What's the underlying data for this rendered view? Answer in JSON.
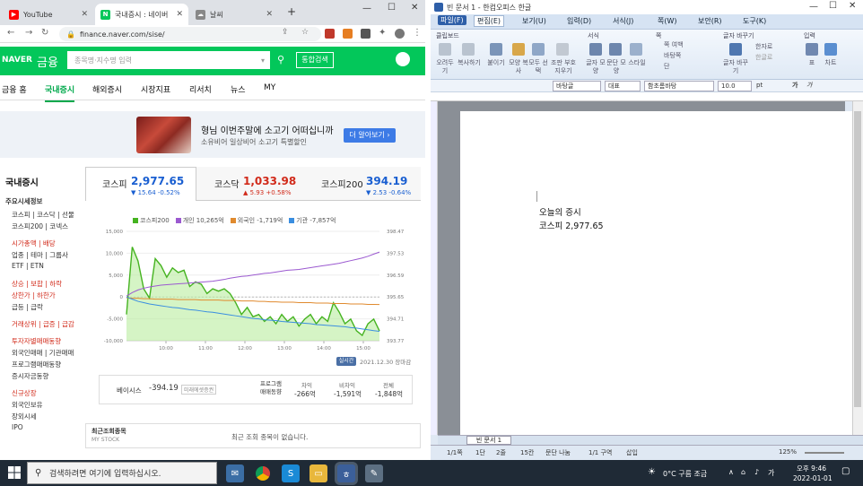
{
  "browser": {
    "tabs": [
      {
        "title": "YouTube"
      },
      {
        "title": "국내증시 : 네이버"
      },
      {
        "title": "날씨"
      }
    ],
    "url": "finance.naver.com/sise/",
    "naver": {
      "logo": "NAVER",
      "section": "금융",
      "search_placeholder": "종목명·지수명 입력",
      "integrated_search": "통합검색",
      "menu": [
        "금융 홈",
        "국내증시",
        "해외증시",
        "시장지표",
        "리서치",
        "뉴스",
        "MY"
      ],
      "ad": {
        "title": "형님 이번주말에 소고기 어떠십니까",
        "sub": "소유비어 일상비어 소고기 특별할인",
        "button": "더 알아보기 ›"
      },
      "sidebar": {
        "title": "국내증시",
        "section1": "주요시세정보",
        "links1": [
          "코스피 | 코스닥 | 선물",
          "코스피200 | 코넥스"
        ],
        "links2": [
          "시가총액 | 배당",
          "업종 | 테마 | 그룹사",
          "ETF | ETN"
        ],
        "links3": [
          "상승 | 보합 | 하락",
          "상한가 | 하한가",
          "급등 | 급락"
        ],
        "links4": [
          "거래상위 | 급증 | 급감"
        ],
        "links5": [
          "투자자별매매동향",
          "외국인매매 | 기관매매",
          "프로그램매매동향",
          "증시자금동향"
        ],
        "section2": "신규상장",
        "links6": [
          "외국인보유",
          "장외시세",
          "IPO"
        ]
      },
      "indices": [
        {
          "name": "코스피",
          "value": "2,977.65",
          "change": "▼ 15.64 -0.52%",
          "dir": "dn"
        },
        {
          "name": "코스닥",
          "value": "1,033.98",
          "change": "▲ 5.93 +0.58%",
          "dir": "up"
        },
        {
          "name": "코스피200",
          "value": "394.19",
          "change": "▼ 2.53 -0.64%",
          "dir": "dn"
        }
      ],
      "legend": [
        "코스피200",
        "개인 10,265억",
        "외국인 -1,719억",
        "기관 -7,857억"
      ],
      "asof": "2021.12.30 장마감",
      "realtime": "실시간",
      "basis": {
        "label": "베이시스",
        "value": "-394.19",
        "tag": "미래에셋증권"
      },
      "program": {
        "label": "프로그램 매매동향",
        "cols": [
          {
            "h": "차익",
            "v": "-266억"
          },
          {
            "h": "비차익",
            "v": "-1,591억"
          },
          {
            "h": "전체",
            "v": "-1,848억"
          }
        ]
      },
      "recent": {
        "label": "최근조회종목",
        "sub": "MY STOCK",
        "empty": "최근 조회 종목이 없습니다."
      }
    }
  },
  "chart_data": {
    "type": "line",
    "x_ticks": [
      "10:00",
      "11:00",
      "12:00",
      "13:00",
      "14:00",
      "15:00"
    ],
    "left_axis": {
      "ticks": [
        "15,000",
        "10,000",
        "5,000",
        "0",
        "-5,000",
        "-10,000"
      ],
      "range": [
        -10000,
        15000
      ]
    },
    "right_axis": {
      "ticks": [
        "398.47",
        "397.53",
        "396.59",
        "395.65",
        "394.71",
        "393.77"
      ],
      "range": [
        393.77,
        398.47
      ]
    },
    "series": [
      {
        "name": "코스피200",
        "color": "#45b320",
        "values": [
          394.9,
          397.8,
          397.2,
          396.0,
          395.6,
          397.3,
          397.0,
          396.5,
          396.9,
          396.7,
          396.8,
          396.1,
          396.3,
          396.2,
          395.8,
          396.0,
          395.9,
          396.0,
          395.8,
          395.4,
          394.9,
          395.2,
          394.8,
          394.9,
          394.6,
          394.8,
          394.5,
          394.9,
          394.6,
          394.8,
          394.4,
          394.7,
          394.9,
          394.5,
          394.8,
          394.6,
          395.4,
          395.0,
          394.5,
          394.7,
          394.2,
          394.0,
          394.5,
          394.7,
          394.19
        ]
      },
      {
        "name": "개인",
        "color": "#9b59d0",
        "values": [
          200,
          1000,
          1600,
          2000,
          2300,
          2500,
          2700,
          2800,
          2900,
          3000,
          3100,
          3200,
          3300,
          3400,
          3500,
          3600,
          3800,
          4000,
          4300,
          4500,
          4700,
          4800,
          5000,
          5200,
          5400,
          5500,
          5700,
          5900,
          6100,
          6200,
          6300,
          6500,
          6700,
          6900,
          7100,
          7300,
          7500,
          7700,
          8000,
          8300,
          8600,
          8900,
          9300,
          9800,
          10265
        ]
      },
      {
        "name": "외국인",
        "color": "#e08a2e",
        "values": [
          -200,
          -300,
          -300,
          -400,
          -400,
          -500,
          -500,
          -500,
          -500,
          -600,
          -600,
          -600,
          -600,
          -700,
          -700,
          -700,
          -700,
          -800,
          -800,
          -800,
          -900,
          -900,
          -900,
          -1000,
          -1000,
          -1100,
          -1100,
          -1200,
          -1200,
          -1200,
          -1300,
          -1300,
          -1300,
          -1400,
          -1400,
          -1400,
          -1500,
          -1500,
          -1500,
          -1600,
          -1600,
          -1600,
          -1700,
          -1700,
          -1719
        ]
      },
      {
        "name": "기관",
        "color": "#3a8ee0",
        "values": [
          0,
          -500,
          -1000,
          -1300,
          -1600,
          -1800,
          -2000,
          -2200,
          -2400,
          -2500,
          -2700,
          -2900,
          -3000,
          -3200,
          -3400,
          -3500,
          -3700,
          -3900,
          -4100,
          -4300,
          -4500,
          -4700,
          -4900,
          -5000,
          -5200,
          -5300,
          -5400,
          -5600,
          -5700,
          -5800,
          -5900,
          -6000,
          -6100,
          -6300,
          -6400,
          -6500,
          -6600,
          -6700,
          -6800,
          -7000,
          -7100,
          -7300,
          -7500,
          -7700,
          -7857
        ]
      }
    ]
  },
  "hwp": {
    "title": "빈 문서 1 - 한컴오피스 한글",
    "menu": [
      "파일(F)",
      "편집(E)",
      "보기(U)",
      "입력(D)",
      "서식(J)",
      "쪽(W)",
      "보안(R)",
      "도구(K)"
    ],
    "groups": [
      "클립보드",
      "서식",
      "쪽",
      "글자 바꾸기",
      "입력"
    ],
    "buttons": [
      "오려두기",
      "복사하기",
      "붙이기",
      "모양 복사",
      "모두 선택",
      "조판 부호 지우기",
      "글자 모양",
      "문단 모양",
      "스타일",
      "쪽 여백",
      "바탕쪽",
      "단",
      "글자 바꾸기",
      "한자로",
      "한글로",
      "표",
      "차트"
    ],
    "format": {
      "style": "바탕글",
      "lang": "대표",
      "font": "함초롬바탕",
      "size": "10.0",
      "unit": "pt"
    },
    "doc_lines": [
      "오늘의 증시",
      "코스피 2,977.65"
    ],
    "doc_tab": "빈 문서 1",
    "status": [
      "1/1쪽",
      "1단",
      "2줄",
      "15칸",
      "문단 나눔",
      "1/1 구역",
      "삽입"
    ],
    "zoom": "125%"
  },
  "taskbar": {
    "search": "검색하려면 여기에 입력하십시오.",
    "weather": "0°C 구름 조금",
    "ime": "가",
    "time": "오후 9:46",
    "date": "2022-01-01"
  },
  "colors": {
    "naver_green": "#03c75a",
    "up": "#d12a1a",
    "down": "#1a5fd1",
    "hwp_blue": "#2e5fa8"
  }
}
